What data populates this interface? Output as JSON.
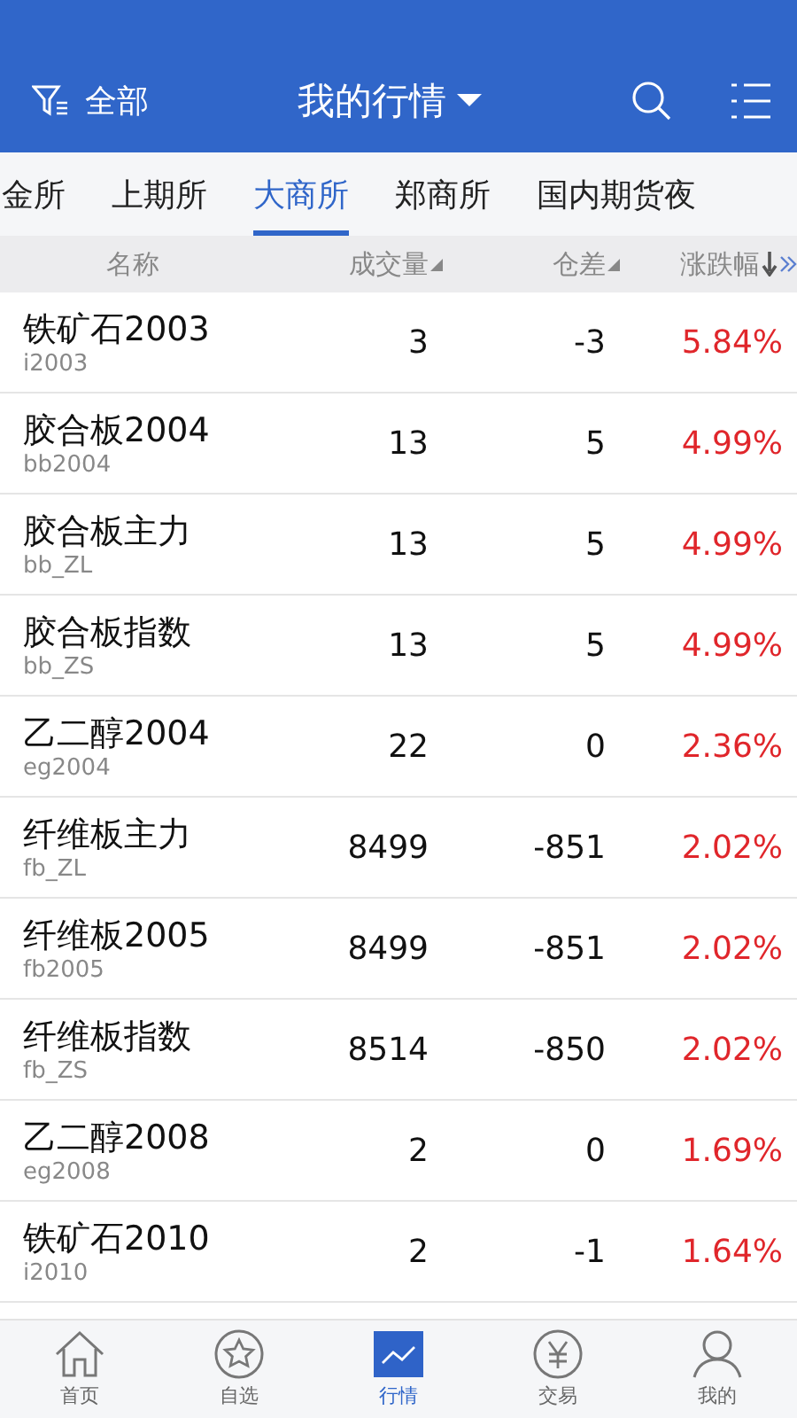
{
  "header": {
    "filter_label": "全部",
    "title": "我的行情"
  },
  "exchange_tabs": [
    {
      "label": "金所",
      "selected": false
    },
    {
      "label": "上期所",
      "selected": false
    },
    {
      "label": "大商所",
      "selected": true
    },
    {
      "label": "郑商所",
      "selected": false
    },
    {
      "label": "国内期货夜",
      "selected": false
    }
  ],
  "table": {
    "columns": [
      {
        "label": "名称",
        "sortable": false
      },
      {
        "label": "成交量",
        "sortable": true,
        "sorted": false
      },
      {
        "label": "仓差",
        "sortable": true,
        "sorted": false
      },
      {
        "label": "涨跌幅",
        "sortable": true,
        "sorted": true,
        "more": true
      }
    ],
    "rows": [
      {
        "name": "铁矿石2003",
        "code": "i2003",
        "volume": "3",
        "oi_change": "-3",
        "change": "5.84%"
      },
      {
        "name": "胶合板2004",
        "code": "bb2004",
        "volume": "13",
        "oi_change": "5",
        "change": "4.99%"
      },
      {
        "name": "胶合板主力",
        "code": "bb_ZL",
        "volume": "13",
        "oi_change": "5",
        "change": "4.99%"
      },
      {
        "name": "胶合板指数",
        "code": "bb_ZS",
        "volume": "13",
        "oi_change": "5",
        "change": "4.99%"
      },
      {
        "name": "乙二醇2004",
        "code": "eg2004",
        "volume": "22",
        "oi_change": "0",
        "change": "2.36%"
      },
      {
        "name": "纤维板主力",
        "code": "fb_ZL",
        "volume": "8499",
        "oi_change": "-851",
        "change": "2.02%"
      },
      {
        "name": "纤维板2005",
        "code": "fb2005",
        "volume": "8499",
        "oi_change": "-851",
        "change": "2.02%"
      },
      {
        "name": "纤维板指数",
        "code": "fb_ZS",
        "volume": "8514",
        "oi_change": "-850",
        "change": "2.02%"
      },
      {
        "name": "乙二醇2008",
        "code": "eg2008",
        "volume": "2",
        "oi_change": "0",
        "change": "1.69%"
      },
      {
        "name": "铁矿石2010",
        "code": "i2010",
        "volume": "2",
        "oi_change": "-1",
        "change": "1.64%"
      }
    ]
  },
  "bottom_nav": [
    {
      "label": "首页",
      "kind": "home",
      "selected": false
    },
    {
      "label": "自选",
      "kind": "star",
      "selected": false
    },
    {
      "label": "行情",
      "kind": "chart",
      "selected": true
    },
    {
      "label": "交易",
      "kind": "yen",
      "selected": false
    },
    {
      "label": "我的",
      "kind": "person",
      "selected": false
    }
  ]
}
